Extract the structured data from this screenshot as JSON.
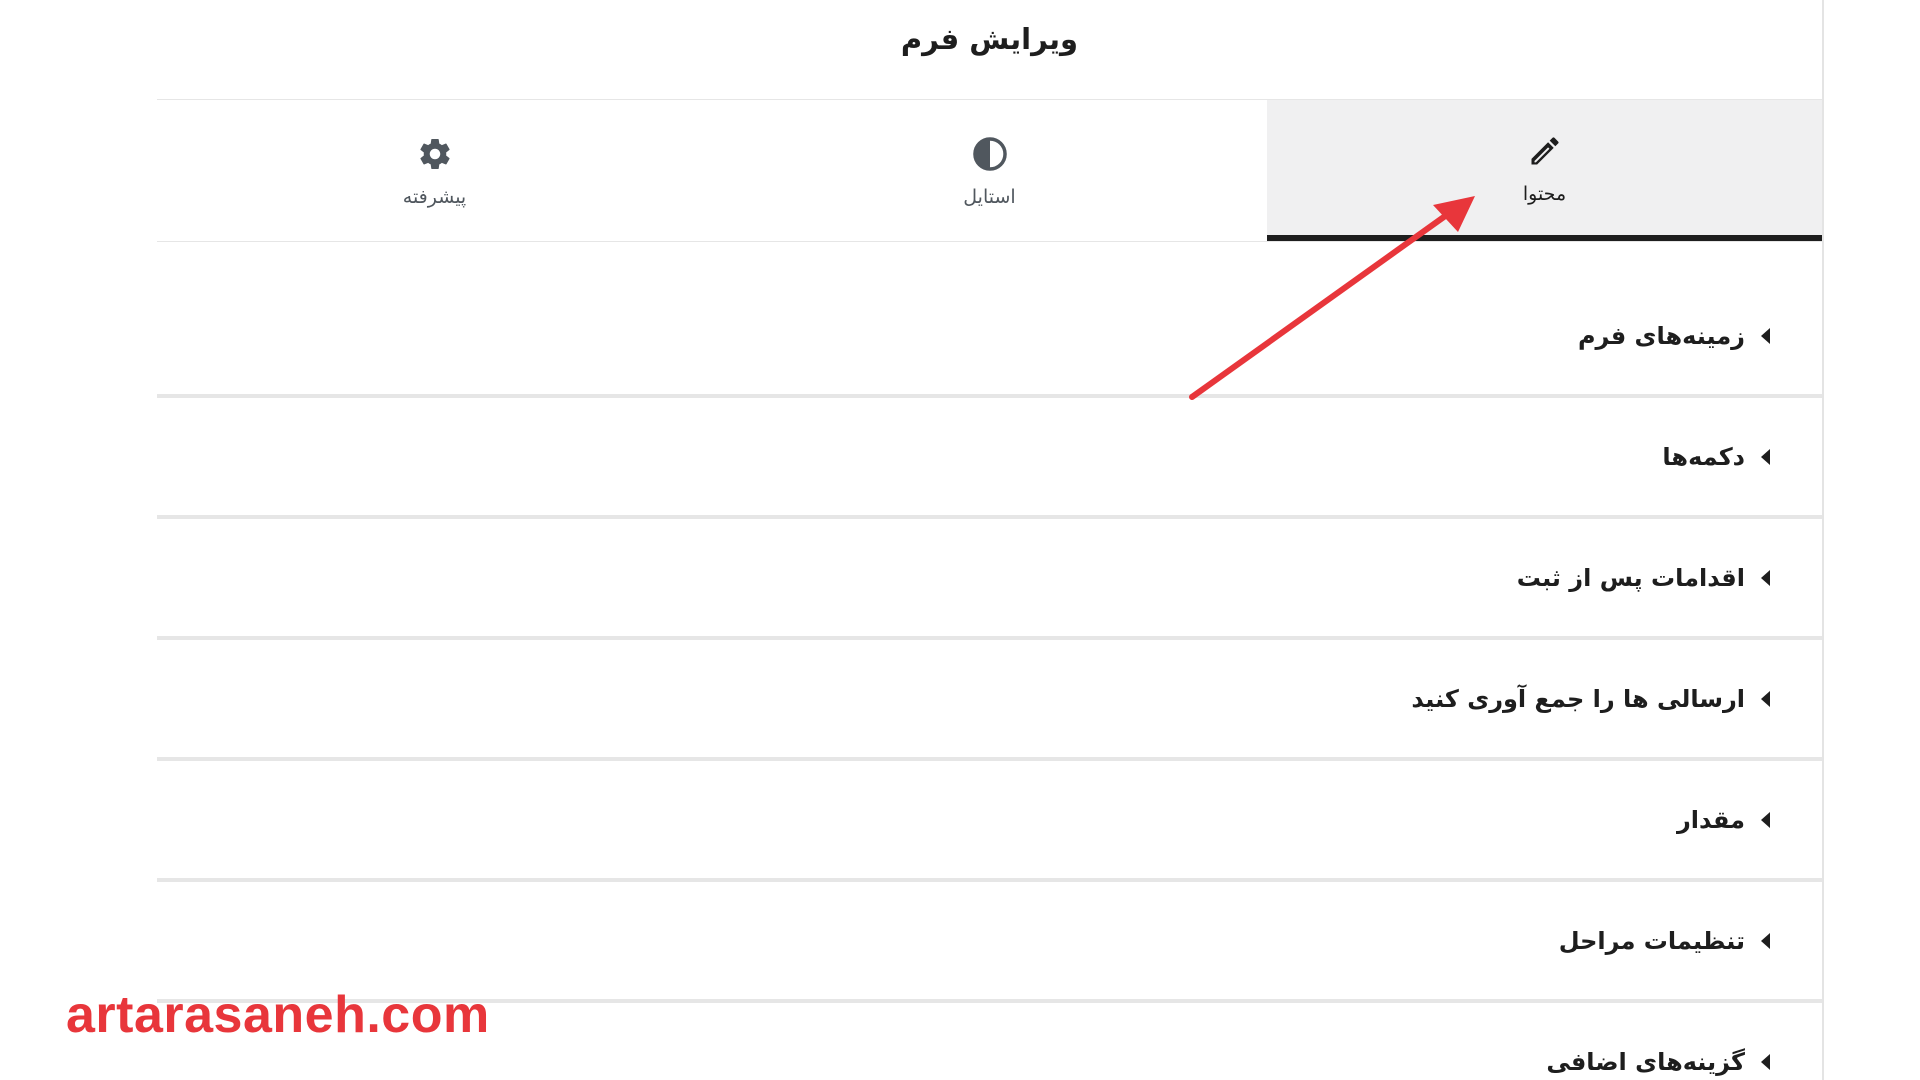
{
  "header": {
    "title": "ویرایش فرم"
  },
  "tabs": [
    {
      "label": "محتوا",
      "icon": "pencil-icon",
      "active": true
    },
    {
      "label": "استایل",
      "icon": "half-circle-contrast-icon",
      "active": false
    },
    {
      "label": "پیشرفته",
      "icon": "gear-icon",
      "active": false
    }
  ],
  "sections": [
    {
      "label": "زمینه‌های فرم"
    },
    {
      "label": "دکمه‌ها"
    },
    {
      "label": "اقدامات پس از ثبت"
    },
    {
      "label": "ارسالی ها را جمع آوری کنید"
    },
    {
      "label": "مقدار"
    },
    {
      "label": "تنظیمات مراحل"
    },
    {
      "label": "گزینه‌های اضافی"
    }
  ],
  "annotation": {
    "arrow_color": "#e8363b"
  },
  "watermark": {
    "text": "artarasaneh.com",
    "color": "#e8363b"
  },
  "colors": {
    "active_tab_bg": "#f0f0f1",
    "active_tab_underline": "#1e1e1e",
    "divider": "#e6e6e6"
  }
}
